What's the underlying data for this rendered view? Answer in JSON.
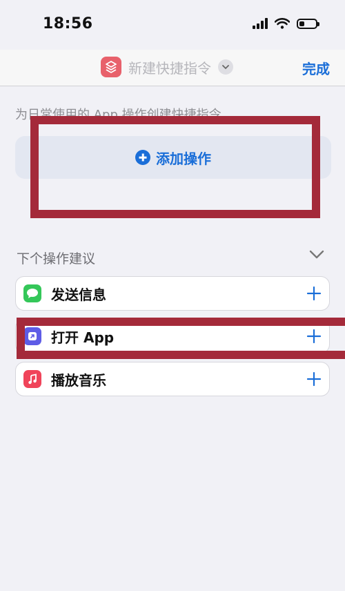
{
  "status_bar": {
    "time": "18:56",
    "battery_level": 0.3
  },
  "nav": {
    "title": "新建快捷指令",
    "done_label": "完成"
  },
  "main": {
    "hint": "为日常使用的 App 操作创建快捷指令",
    "add_action_label": "添加操作",
    "suggestions_title": "下个操作建议",
    "suggestions": [
      {
        "label": "发送信息",
        "icon": "messages-icon",
        "color": "#34c759"
      },
      {
        "label": "打开 App",
        "icon": "open-app-icon",
        "color": "#5e5ce6"
      },
      {
        "label": "播放音乐",
        "icon": "music-icon",
        "color": "#f0445a"
      }
    ]
  },
  "colors": {
    "accent": "#1a6ed8",
    "annotation_red": "#a42a3a",
    "shortcut_icon": "#e8616b"
  }
}
